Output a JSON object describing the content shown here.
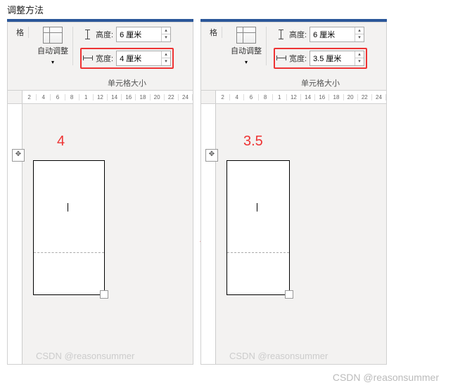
{
  "title": "调整方法",
  "ribbon": {
    "grid_label": "格",
    "autofit_label": "自动调整",
    "height_label": "高度:",
    "width_label": "宽度:",
    "group_label": "单元格大小"
  },
  "left": {
    "height_value": "6 厘米",
    "width_value": "4 厘米",
    "annotation": "4",
    "ruler": [
      "2",
      "4",
      "6",
      "8",
      "1",
      "12",
      "14",
      "16",
      "18",
      "20",
      "22",
      "24"
    ]
  },
  "right": {
    "height_value": "6 厘米",
    "width_value": "3.5 厘米",
    "annotation": "3.5",
    "ruler": [
      "2",
      "4",
      "6",
      "8",
      "1",
      "12",
      "14",
      "16",
      "18",
      "20",
      "22",
      "24"
    ]
  },
  "watermark": "CSDN @reasonsummer",
  "outer_watermark": "CSDN @reasonsummer",
  "arrow": "→"
}
